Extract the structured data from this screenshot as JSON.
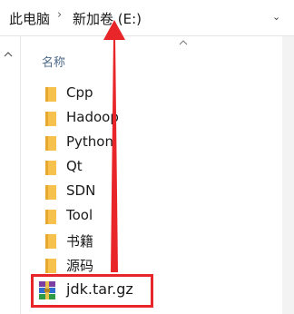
{
  "breadcrumb": {
    "items": [
      "此电脑",
      "新加卷 (E:)"
    ],
    "separator": "›",
    "dropdown_icon": "chevron-down-icon"
  },
  "column_header": {
    "name_label": "名称",
    "sort_icon": "sort-chevron-up-icon"
  },
  "folders": [
    {
      "name": "Cpp"
    },
    {
      "name": "Hadoop"
    },
    {
      "name": "Python"
    },
    {
      "name": "Qt"
    },
    {
      "name": "SDN"
    },
    {
      "name": "Tool"
    },
    {
      "name": "书籍"
    },
    {
      "name": "源码"
    }
  ],
  "files": [
    {
      "name": "jdk.tar.gz",
      "icon": "winrar-archive-icon"
    }
  ],
  "annotation": {
    "color": "#e8262a",
    "shape": "arrow-and-box"
  },
  "colors": {
    "folder": "#f6c24d",
    "header_text": "#4d6a8a",
    "annotation": "#e8262a"
  }
}
